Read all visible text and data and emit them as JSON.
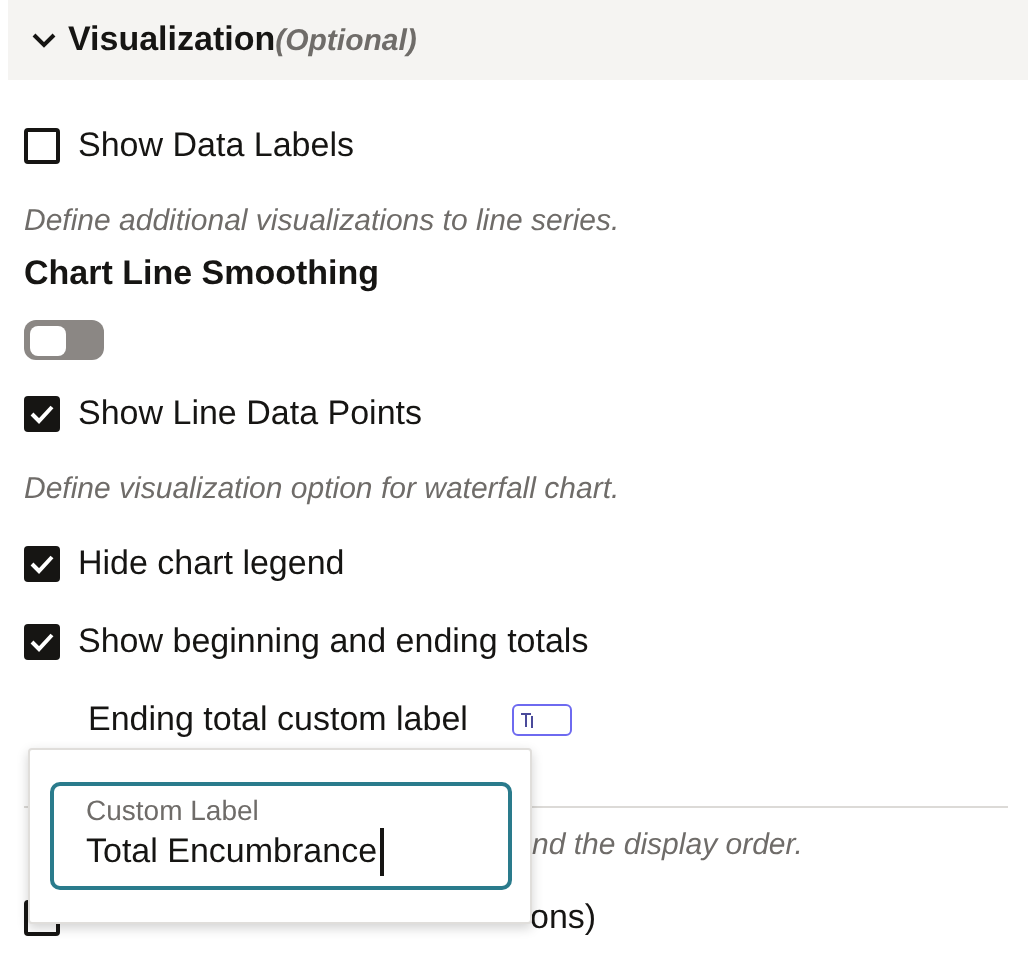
{
  "section": {
    "title": "Visualization",
    "note": "(Optional)",
    "expanded": true
  },
  "items": [
    {
      "kind": "checkbox",
      "label": "Show Data Labels",
      "checked": false
    },
    {
      "kind": "hint",
      "text": "Define additional visualizations to line series."
    },
    {
      "kind": "heading",
      "text": "Chart Line Smoothing"
    },
    {
      "kind": "toggle",
      "on": false
    },
    {
      "kind": "checkbox",
      "label": "Show Line Data Points",
      "checked": true
    },
    {
      "kind": "hint",
      "text": "Define visualization option for waterfall chart."
    },
    {
      "kind": "checkbox",
      "label": "Hide chart legend",
      "checked": true
    },
    {
      "kind": "checkbox",
      "label": "Show beginning and ending totals",
      "checked": true
    },
    {
      "kind": "custom_label",
      "label": "Ending total custom label"
    },
    {
      "kind": "divider"
    },
    {
      "kind": "covered_hint",
      "text": "nd the display order."
    },
    {
      "kind": "covered_checkbox",
      "label": "ons)",
      "checked": false
    }
  ],
  "popup": {
    "label": "Custom Label",
    "value": "Total Encumbrance"
  }
}
